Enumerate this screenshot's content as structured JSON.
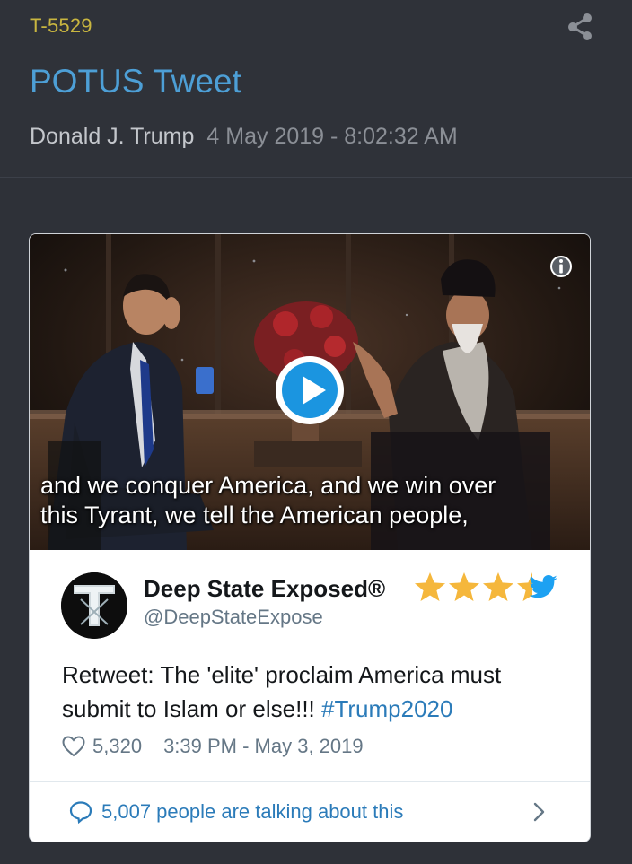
{
  "post": {
    "id": "T-5529",
    "title": "POTUS Tweet",
    "author": "Donald J. Trump",
    "date": "4 May 2019 - 8:02:32 AM"
  },
  "video": {
    "caption_line1": "and we conquer America, and we win over",
    "caption_line2": "this Tyrant, we tell the American people,"
  },
  "tweet": {
    "display_name": "Deep State Exposed®",
    "handle": "@DeepStateExpose",
    "text": "Retweet: The 'elite' proclaim America must submit to Islam or else!!!",
    "hashtag": "#Trump2020",
    "likes": "5,320",
    "timestamp": "3:39 PM - May 3, 2019",
    "talking": "5,007 people are talking about this"
  },
  "colors": {
    "accent_blue": "#4d9fd6",
    "id_yellow": "#c9b640",
    "twitter_blue": "#2b7bb9",
    "star_gold": "#f5b73c"
  },
  "icons": [
    "share-icon",
    "info-icon",
    "play-icon",
    "star-icon",
    "twitter-bird-icon",
    "heart-icon",
    "speech-bubble-icon",
    "chevron-right-icon"
  ]
}
